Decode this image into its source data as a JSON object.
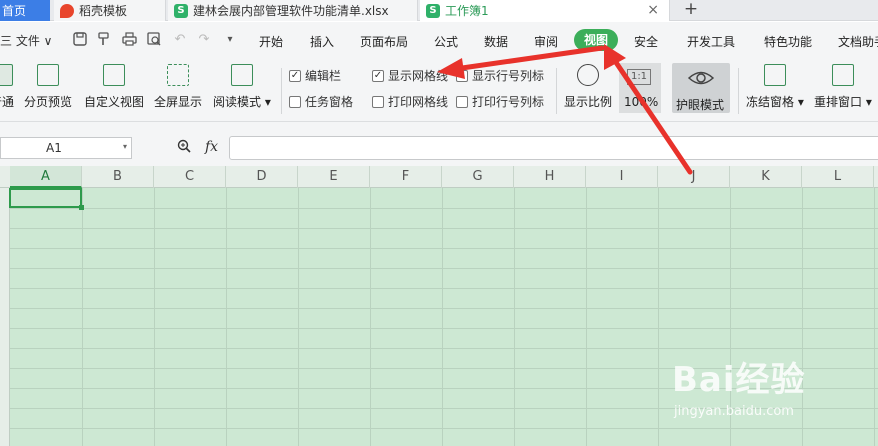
{
  "tabs": {
    "home": "首页",
    "docer": "稻壳模板",
    "xlsx": "建林会展内部管理软件功能清单.xlsx",
    "active": "工作簿1",
    "close": "×",
    "new_tab": "+"
  },
  "menubar": {
    "file": "三 文件 ∨",
    "items": [
      "开始",
      "插入",
      "页面布局",
      "公式",
      "数据",
      "审阅",
      "视图",
      "安全",
      "开发工具",
      "特色功能",
      "文档助手"
    ]
  },
  "ribbon": {
    "buttons": [
      "普通",
      "分页预览",
      "自定义视图",
      "全屏显示",
      "阅读模式"
    ],
    "checkboxes": [
      {
        "label": "编辑栏",
        "checked": true
      },
      {
        "label": "显示网格线",
        "checked": true
      },
      {
        "label": "显示行号列标",
        "checked": true
      },
      {
        "label": "任务窗格",
        "checked": false
      },
      {
        "label": "打印网格线",
        "checked": false
      },
      {
        "label": "打印行号列标",
        "checked": false
      }
    ],
    "zoom": {
      "label": "显示比例",
      "ratio_icon": "1:1",
      "value": "100%"
    },
    "eye_mode": "护眼模式",
    "freeze": "冻结窗格",
    "rearrange": "重排窗口"
  },
  "formula_bar": {
    "name_box": "A1",
    "fx": "fx",
    "value": ""
  },
  "grid": {
    "columns": [
      "A",
      "B",
      "C",
      "D",
      "E",
      "F",
      "G",
      "H",
      "I",
      "J",
      "K",
      "L"
    ],
    "active_cell": "A1",
    "background": "#cde8d3"
  },
  "watermark": {
    "brand": "Bai经验",
    "url": "jingyan.baidu.com"
  },
  "colors": {
    "accent": "#3cae5a",
    "arrow": "#e8322b",
    "home_tab": "#3c7ee6"
  }
}
